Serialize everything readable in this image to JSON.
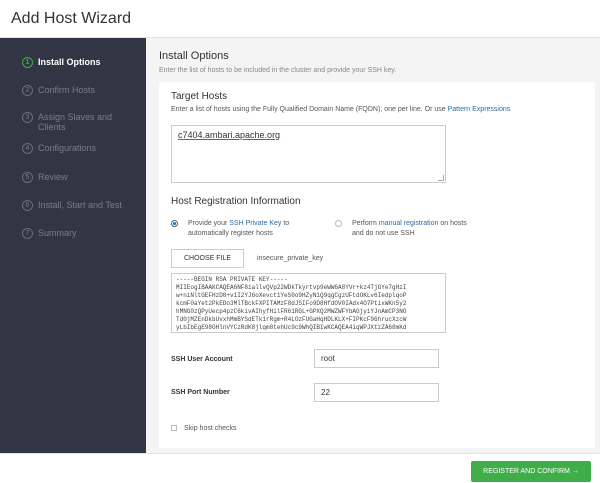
{
  "modal": {
    "title": "Add Host Wizard"
  },
  "sidebar": {
    "steps": [
      {
        "num": "1",
        "label": "Install Options",
        "active": true
      },
      {
        "num": "2",
        "label": "Confirm Hosts"
      },
      {
        "num": "3",
        "label": "Assign Slaves and Clients"
      },
      {
        "num": "4",
        "label": "Configurations"
      },
      {
        "num": "5",
        "label": "Review"
      },
      {
        "num": "6",
        "label": "Install, Start and Test"
      },
      {
        "num": "7",
        "label": "Summary"
      }
    ]
  },
  "main": {
    "title": "Install Options",
    "description": "Enter the list of hosts to be included in the cluster and provide your SSH key.",
    "target_hosts": {
      "title": "Target Hosts",
      "help_text": "Enter a list of hosts using the Fully Qualified Domain Name (FQDN), one per line. Or use",
      "help_link": "Pattern Expressions",
      "value": "c7404.ambari.apache.org"
    },
    "host_registration": {
      "title": "Host Registration Information",
      "option1_pre": "Provide your",
      "option1_link": "SSH Private Key",
      "option1_post": "to",
      "option1_line2": "automatically register hosts",
      "option2_pre": "Perform",
      "option2_link": "manual registration",
      "option2_post": "on hosts",
      "option2_line2": "and do not use SSH",
      "choose_file_label": "CHOOSE FILE",
      "file_name": "insecure_private_key",
      "key_text": "-----BEGIN RSA PRIVATE KEY-----\nMIIEogIBAAKCAQEA6NF8iallvQVp22WDkTkyrtvp9eWW6A8YVr+kz4TjGYe7gHzI\nw+niNltGEFHzD8+v1I2YJ6oXevct1YeS0o9HZyN1Q9qgCgzUFtdOKLv6IedplqoP\nkcmF0aYet2PkEDo3MlTBckFXPITAMzF8dJSIFo9D8HfdOV0IAdx4O7PtixWKn5y2\nhMNG0zQPyUecp4pzC6kivAIhyfHilFR61RGL+GPXQ2MWZWFYbAGjyiYJnAmCP3NO\nTd0jMZEnDkbUvxhMmBYSdETk1rRgm+R4LOzFUGaHqHDLKLX+FIPKcF96hrucXzcW\nyLbIbEgE98OHlnVYCzRdK8jlqm8tehUc9c9WhQIBIwKCAQEA4iqWPJXtzZA68mKd"
    },
    "ssh_user": {
      "label": "SSH User Account",
      "value": "root"
    },
    "ssh_port": {
      "label": "SSH Port Number",
      "value": "22"
    },
    "skip_checks_label": "Skip host checks"
  },
  "footer": {
    "register_label": "REGISTER AND CONFIRM →"
  },
  "colors": {
    "accent": "#3fae49",
    "sidebar": "#323544",
    "link": "#2e6aa0"
  }
}
